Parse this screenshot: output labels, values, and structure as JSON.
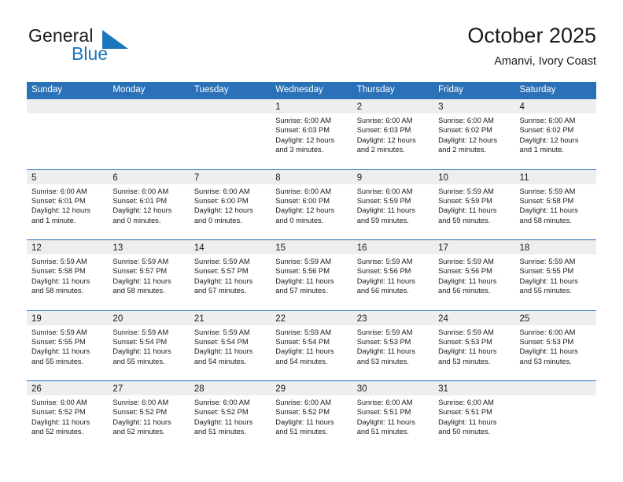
{
  "logo": {
    "word_one": "General",
    "word_two": "Blue",
    "triangle_color": "#1b75bb",
    "text_color": "#1a1a1a"
  },
  "header": {
    "title": "October 2025",
    "location": "Amanvi, Ivory Coast"
  },
  "theme": {
    "header_row_bg": "#2b71b8",
    "header_row_text": "#ffffff",
    "date_band_bg": "#eeeeee",
    "grid_line": "#2b71b8",
    "body_text": "#1a1a1a"
  },
  "weekdays": [
    "Sunday",
    "Monday",
    "Tuesday",
    "Wednesday",
    "Thursday",
    "Friday",
    "Saturday"
  ],
  "weeks": [
    [
      {
        "date": "",
        "empty": true,
        "sunrise": "",
        "sunset": "",
        "daylight_line1": "",
        "daylight_line2": ""
      },
      {
        "date": "",
        "empty": true,
        "sunrise": "",
        "sunset": "",
        "daylight_line1": "",
        "daylight_line2": ""
      },
      {
        "date": "",
        "empty": true,
        "sunrise": "",
        "sunset": "",
        "daylight_line1": "",
        "daylight_line2": ""
      },
      {
        "date": "1",
        "empty": false,
        "sunrise": "Sunrise: 6:00 AM",
        "sunset": "Sunset: 6:03 PM",
        "daylight_line1": "Daylight: 12 hours",
        "daylight_line2": "and 3 minutes."
      },
      {
        "date": "2",
        "empty": false,
        "sunrise": "Sunrise: 6:00 AM",
        "sunset": "Sunset: 6:03 PM",
        "daylight_line1": "Daylight: 12 hours",
        "daylight_line2": "and 2 minutes."
      },
      {
        "date": "3",
        "empty": false,
        "sunrise": "Sunrise: 6:00 AM",
        "sunset": "Sunset: 6:02 PM",
        "daylight_line1": "Daylight: 12 hours",
        "daylight_line2": "and 2 minutes."
      },
      {
        "date": "4",
        "empty": false,
        "sunrise": "Sunrise: 6:00 AM",
        "sunset": "Sunset: 6:02 PM",
        "daylight_line1": "Daylight: 12 hours",
        "daylight_line2": "and 1 minute."
      }
    ],
    [
      {
        "date": "5",
        "empty": false,
        "sunrise": "Sunrise: 6:00 AM",
        "sunset": "Sunset: 6:01 PM",
        "daylight_line1": "Daylight: 12 hours",
        "daylight_line2": "and 1 minute."
      },
      {
        "date": "6",
        "empty": false,
        "sunrise": "Sunrise: 6:00 AM",
        "sunset": "Sunset: 6:01 PM",
        "daylight_line1": "Daylight: 12 hours",
        "daylight_line2": "and 0 minutes."
      },
      {
        "date": "7",
        "empty": false,
        "sunrise": "Sunrise: 6:00 AM",
        "sunset": "Sunset: 6:00 PM",
        "daylight_line1": "Daylight: 12 hours",
        "daylight_line2": "and 0 minutes."
      },
      {
        "date": "8",
        "empty": false,
        "sunrise": "Sunrise: 6:00 AM",
        "sunset": "Sunset: 6:00 PM",
        "daylight_line1": "Daylight: 12 hours",
        "daylight_line2": "and 0 minutes."
      },
      {
        "date": "9",
        "empty": false,
        "sunrise": "Sunrise: 6:00 AM",
        "sunset": "Sunset: 5:59 PM",
        "daylight_line1": "Daylight: 11 hours",
        "daylight_line2": "and 59 minutes."
      },
      {
        "date": "10",
        "empty": false,
        "sunrise": "Sunrise: 5:59 AM",
        "sunset": "Sunset: 5:59 PM",
        "daylight_line1": "Daylight: 11 hours",
        "daylight_line2": "and 59 minutes."
      },
      {
        "date": "11",
        "empty": false,
        "sunrise": "Sunrise: 5:59 AM",
        "sunset": "Sunset: 5:58 PM",
        "daylight_line1": "Daylight: 11 hours",
        "daylight_line2": "and 58 minutes."
      }
    ],
    [
      {
        "date": "12",
        "empty": false,
        "sunrise": "Sunrise: 5:59 AM",
        "sunset": "Sunset: 5:58 PM",
        "daylight_line1": "Daylight: 11 hours",
        "daylight_line2": "and 58 minutes."
      },
      {
        "date": "13",
        "empty": false,
        "sunrise": "Sunrise: 5:59 AM",
        "sunset": "Sunset: 5:57 PM",
        "daylight_line1": "Daylight: 11 hours",
        "daylight_line2": "and 58 minutes."
      },
      {
        "date": "14",
        "empty": false,
        "sunrise": "Sunrise: 5:59 AM",
        "sunset": "Sunset: 5:57 PM",
        "daylight_line1": "Daylight: 11 hours",
        "daylight_line2": "and 57 minutes."
      },
      {
        "date": "15",
        "empty": false,
        "sunrise": "Sunrise: 5:59 AM",
        "sunset": "Sunset: 5:56 PM",
        "daylight_line1": "Daylight: 11 hours",
        "daylight_line2": "and 57 minutes."
      },
      {
        "date": "16",
        "empty": false,
        "sunrise": "Sunrise: 5:59 AM",
        "sunset": "Sunset: 5:56 PM",
        "daylight_line1": "Daylight: 11 hours",
        "daylight_line2": "and 56 minutes."
      },
      {
        "date": "17",
        "empty": false,
        "sunrise": "Sunrise: 5:59 AM",
        "sunset": "Sunset: 5:56 PM",
        "daylight_line1": "Daylight: 11 hours",
        "daylight_line2": "and 56 minutes."
      },
      {
        "date": "18",
        "empty": false,
        "sunrise": "Sunrise: 5:59 AM",
        "sunset": "Sunset: 5:55 PM",
        "daylight_line1": "Daylight: 11 hours",
        "daylight_line2": "and 55 minutes."
      }
    ],
    [
      {
        "date": "19",
        "empty": false,
        "sunrise": "Sunrise: 5:59 AM",
        "sunset": "Sunset: 5:55 PM",
        "daylight_line1": "Daylight: 11 hours",
        "daylight_line2": "and 55 minutes."
      },
      {
        "date": "20",
        "empty": false,
        "sunrise": "Sunrise: 5:59 AM",
        "sunset": "Sunset: 5:54 PM",
        "daylight_line1": "Daylight: 11 hours",
        "daylight_line2": "and 55 minutes."
      },
      {
        "date": "21",
        "empty": false,
        "sunrise": "Sunrise: 5:59 AM",
        "sunset": "Sunset: 5:54 PM",
        "daylight_line1": "Daylight: 11 hours",
        "daylight_line2": "and 54 minutes."
      },
      {
        "date": "22",
        "empty": false,
        "sunrise": "Sunrise: 5:59 AM",
        "sunset": "Sunset: 5:54 PM",
        "daylight_line1": "Daylight: 11 hours",
        "daylight_line2": "and 54 minutes."
      },
      {
        "date": "23",
        "empty": false,
        "sunrise": "Sunrise: 5:59 AM",
        "sunset": "Sunset: 5:53 PM",
        "daylight_line1": "Daylight: 11 hours",
        "daylight_line2": "and 53 minutes."
      },
      {
        "date": "24",
        "empty": false,
        "sunrise": "Sunrise: 5:59 AM",
        "sunset": "Sunset: 5:53 PM",
        "daylight_line1": "Daylight: 11 hours",
        "daylight_line2": "and 53 minutes."
      },
      {
        "date": "25",
        "empty": false,
        "sunrise": "Sunrise: 6:00 AM",
        "sunset": "Sunset: 5:53 PM",
        "daylight_line1": "Daylight: 11 hours",
        "daylight_line2": "and 53 minutes."
      }
    ],
    [
      {
        "date": "26",
        "empty": false,
        "sunrise": "Sunrise: 6:00 AM",
        "sunset": "Sunset: 5:52 PM",
        "daylight_line1": "Daylight: 11 hours",
        "daylight_line2": "and 52 minutes."
      },
      {
        "date": "27",
        "empty": false,
        "sunrise": "Sunrise: 6:00 AM",
        "sunset": "Sunset: 5:52 PM",
        "daylight_line1": "Daylight: 11 hours",
        "daylight_line2": "and 52 minutes."
      },
      {
        "date": "28",
        "empty": false,
        "sunrise": "Sunrise: 6:00 AM",
        "sunset": "Sunset: 5:52 PM",
        "daylight_line1": "Daylight: 11 hours",
        "daylight_line2": "and 51 minutes."
      },
      {
        "date": "29",
        "empty": false,
        "sunrise": "Sunrise: 6:00 AM",
        "sunset": "Sunset: 5:52 PM",
        "daylight_line1": "Daylight: 11 hours",
        "daylight_line2": "and 51 minutes."
      },
      {
        "date": "30",
        "empty": false,
        "sunrise": "Sunrise: 6:00 AM",
        "sunset": "Sunset: 5:51 PM",
        "daylight_line1": "Daylight: 11 hours",
        "daylight_line2": "and 51 minutes."
      },
      {
        "date": "31",
        "empty": false,
        "sunrise": "Sunrise: 6:00 AM",
        "sunset": "Sunset: 5:51 PM",
        "daylight_line1": "Daylight: 11 hours",
        "daylight_line2": "and 50 minutes."
      },
      {
        "date": "",
        "empty": true,
        "sunrise": "",
        "sunset": "",
        "daylight_line1": "",
        "daylight_line2": ""
      }
    ]
  ]
}
